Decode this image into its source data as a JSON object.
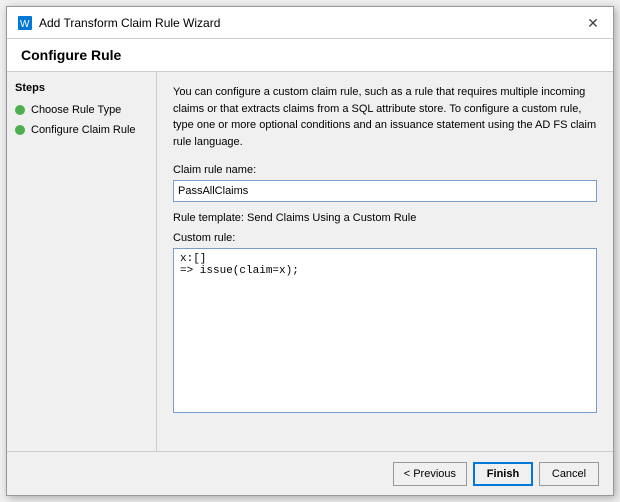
{
  "dialog": {
    "title": "Add Transform Claim Rule Wizard"
  },
  "page_header": {
    "title": "Configure Rule"
  },
  "sidebar": {
    "title": "Steps",
    "items": [
      {
        "id": "choose-rule-type",
        "label": "Choose Rule Type",
        "active": true
      },
      {
        "id": "configure-claim-rule",
        "label": "Configure Claim Rule",
        "active": true
      }
    ]
  },
  "main": {
    "description": "You can configure a custom claim rule, such as a rule that requires multiple incoming claims or that extracts claims from a SQL attribute store. To configure a custom rule, type one or more optional conditions and an issuance statement using the AD FS claim rule language.",
    "claim_rule_name_label": "Claim rule name:",
    "claim_rule_name_value": "PassAllClaims",
    "rule_template_text": "Rule template: Send Claims Using a Custom Rule",
    "custom_rule_label": "Custom rule:",
    "custom_rule_value": "x:[]\n=> issue(claim=x);"
  },
  "footer": {
    "previous_label": "< Previous",
    "finish_label": "Finish",
    "cancel_label": "Cancel"
  },
  "icons": {
    "close": "✕",
    "wizard": "🔧"
  }
}
